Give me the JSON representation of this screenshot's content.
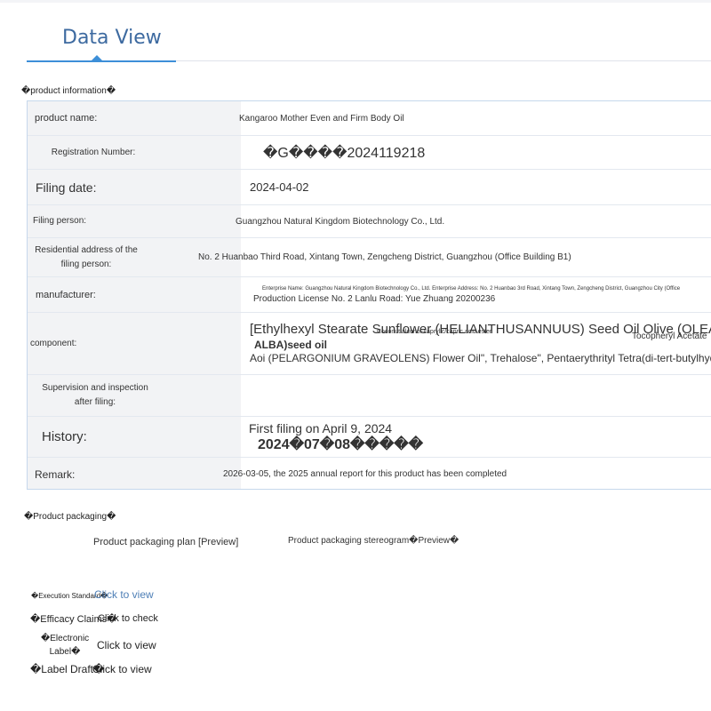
{
  "header": {
    "tab_label": "Data View"
  },
  "sections": {
    "product_info_title": "�product information�",
    "packaging_title": "�Product packaging�"
  },
  "product": {
    "name_label": "product name:",
    "name_value": "Kangaroo Mother Even and Firm Body Oil",
    "reg_label": "Registration Number:",
    "reg_value": "�G����2024119218",
    "filing_date_label": "Filing date:",
    "filing_date_value": "2024-04-02",
    "filing_person_label": "Filing person:",
    "filing_person_value": "Guangzhou Natural Kingdom Biotechnology Co., Ltd.",
    "address_label": "Residential address of the filing person:",
    "address_value": "No. 2 Huanbao Third Road, Xintang Town, Zengcheng District, Guangzhou (Office Building B1)",
    "manufacturer_label": "manufacturer:",
    "manufacturer_line1": "Enterprise Name: Guangzhou Natural Kingdom Biotechnology Co., Ltd. Enterprise Address: No. 2 Huanbao 3rd Road, Xintang Town, Zengcheng District, Guangzhou City (Office",
    "manufacturer_line2": "Production License No. 2 Lanlu Road: Yue Zhuang 20200236",
    "component_label": "component:",
    "component_line1": "[Ethylhexyl Stearate Sunflower (HELIANTHUSANNUUS) Seed Oil Olive (OLEAEUROPAEA",
    "component_line2a": "ALBA)seed oil",
    "component_line2b": "Coconut alcohol-caprylic/capric acid ester",
    "component_line2c": "Tocopheryl Acetate",
    "component_line3": "Aoi (PELARGONIUM GRAVEOLENS) Flower Oil\", Trehalose\", Pentaerythrityl Tetra(di-tert-butylhydroxyhy",
    "supervision_label": "Supervision and inspection after filing:",
    "supervision_value": "",
    "history_label": "History:",
    "history_line1": "First filing on April 9, 2024",
    "history_line2": "2024�07�08�����",
    "remark_label": "Remark:",
    "remark_value": "2026-03-05, the 2025 annual report for this product has been completed"
  },
  "packaging": {
    "plan_link": "Product packaging plan [Preview]",
    "stereogram_link": "Product packaging stereogram�Preview�"
  },
  "documents": [
    {
      "label": "�Execution Standard�",
      "action": "Click to view"
    },
    {
      "label": "�Efficacy Claims�",
      "action": "Click to check"
    },
    {
      "label": "�Electronic Label�",
      "action": "Click to view"
    },
    {
      "label": "�Label Draft�",
      "action": "Click to view"
    }
  ],
  "colors": {
    "accent": "#3d8fd8",
    "title": "#3d6aa0",
    "label_bg": "#f2f3f5",
    "border": "#c6d8ec",
    "link_blue": "#4e7fb6"
  }
}
